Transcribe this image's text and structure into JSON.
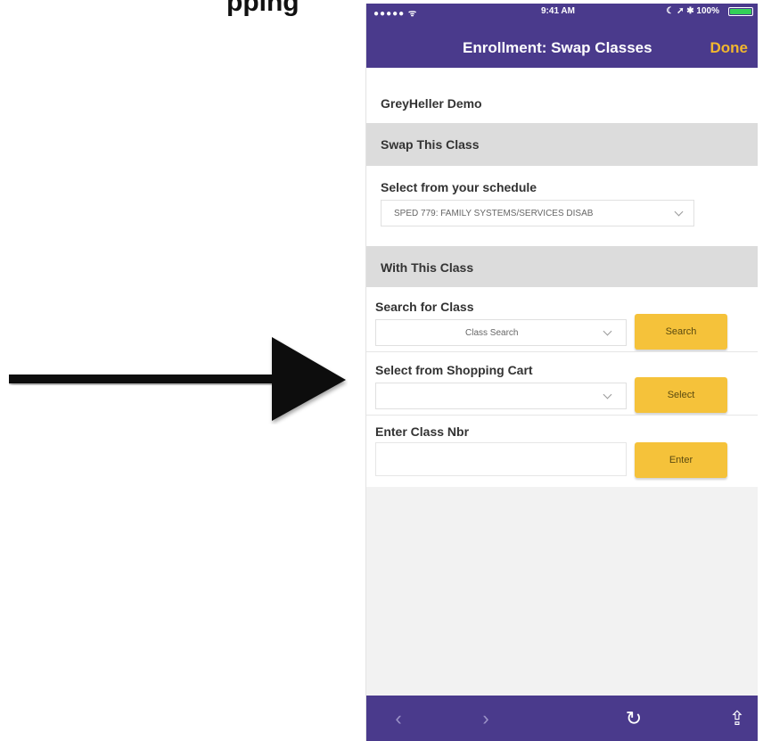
{
  "doc": {
    "heading": "pping"
  },
  "status_bar": {
    "signal": "●●●●● ᯤ",
    "time": "9:41 AM",
    "right": "☾ ➚ ✱ 100%"
  },
  "nav": {
    "title": "Enrollment: Swap Classes",
    "done_label": "Done"
  },
  "account": {
    "name": "GreyHeller Demo"
  },
  "swap_section": {
    "header": "Swap This Class",
    "select_label": "Select from your schedule",
    "selected_value": "SPED 779: FAMILY SYSTEMS/SERVICES DISAB"
  },
  "with_section": {
    "header": "With This Class",
    "search_label": "Search for Class",
    "search_placeholder": "Class Search",
    "search_button": "Search",
    "cart_label": "Select from Shopping Cart",
    "cart_value": "",
    "select_button": "Select",
    "nbr_label": "Enter Class Nbr",
    "nbr_value": "",
    "enter_button": "Enter"
  },
  "toolbar": {
    "back": "‹",
    "forward": "›",
    "reload": "↻",
    "share": "⇪"
  },
  "colors": {
    "brand": "#4a3a8c",
    "accent": "#f5c23a",
    "done": "#f2b72e"
  },
  "icons": [
    "arrow-pointer",
    "battery-icon",
    "chevron-down-icon",
    "back-icon",
    "forward-icon",
    "reload-icon",
    "share-icon"
  ]
}
